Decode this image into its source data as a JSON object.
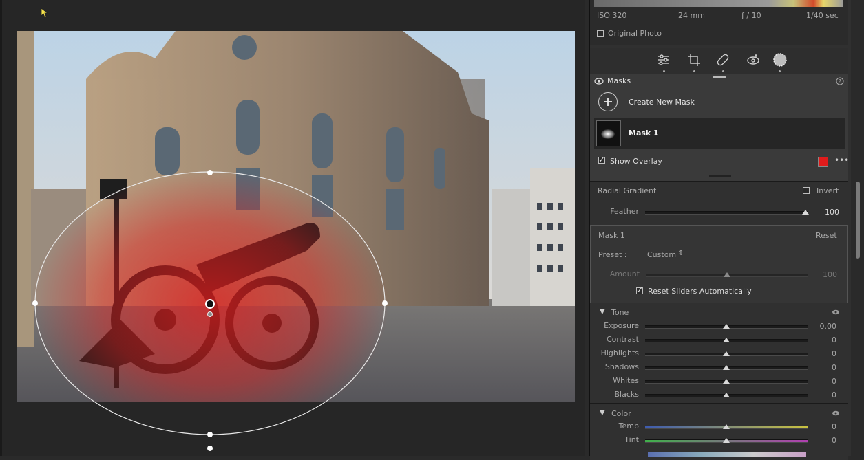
{
  "info": {
    "iso": "ISO 320",
    "focal": "24 mm",
    "aperture": "ƒ / 10",
    "shutter": "1/40 sec",
    "original_photo": "Original Photo"
  },
  "masks_header": {
    "title": "Masks"
  },
  "create_mask": "Create New Mask",
  "mask_item": "Mask 1",
  "show_overlay": "Show Overlay",
  "overlay_color": "#e01b1b",
  "gradient": {
    "title": "Radial Gradient",
    "invert": "Invert",
    "feather_label": "Feather",
    "feather_value": "100",
    "feather": 1.0
  },
  "mask_settings": {
    "title": "Mask 1",
    "reset": "Reset",
    "preset_label": "Preset :",
    "preset_value": "Custom",
    "amount_label": "Amount",
    "amount_value": "100",
    "reset_sliders": "Reset Sliders Automatically"
  },
  "tone": {
    "title": "Tone",
    "sliders": [
      {
        "label": "Exposure",
        "value": "0.00"
      },
      {
        "label": "Contrast",
        "value": "0"
      },
      {
        "label": "Highlights",
        "value": "0"
      },
      {
        "label": "Shadows",
        "value": "0"
      },
      {
        "label": "Whites",
        "value": "0"
      },
      {
        "label": "Blacks",
        "value": "0"
      }
    ]
  },
  "color": {
    "title": "Color",
    "sliders": [
      {
        "label": "Temp",
        "value": "0"
      },
      {
        "label": "Tint",
        "value": "0"
      }
    ]
  },
  "colors": {
    "accent": "#e01b1b",
    "panel": "#303030"
  }
}
